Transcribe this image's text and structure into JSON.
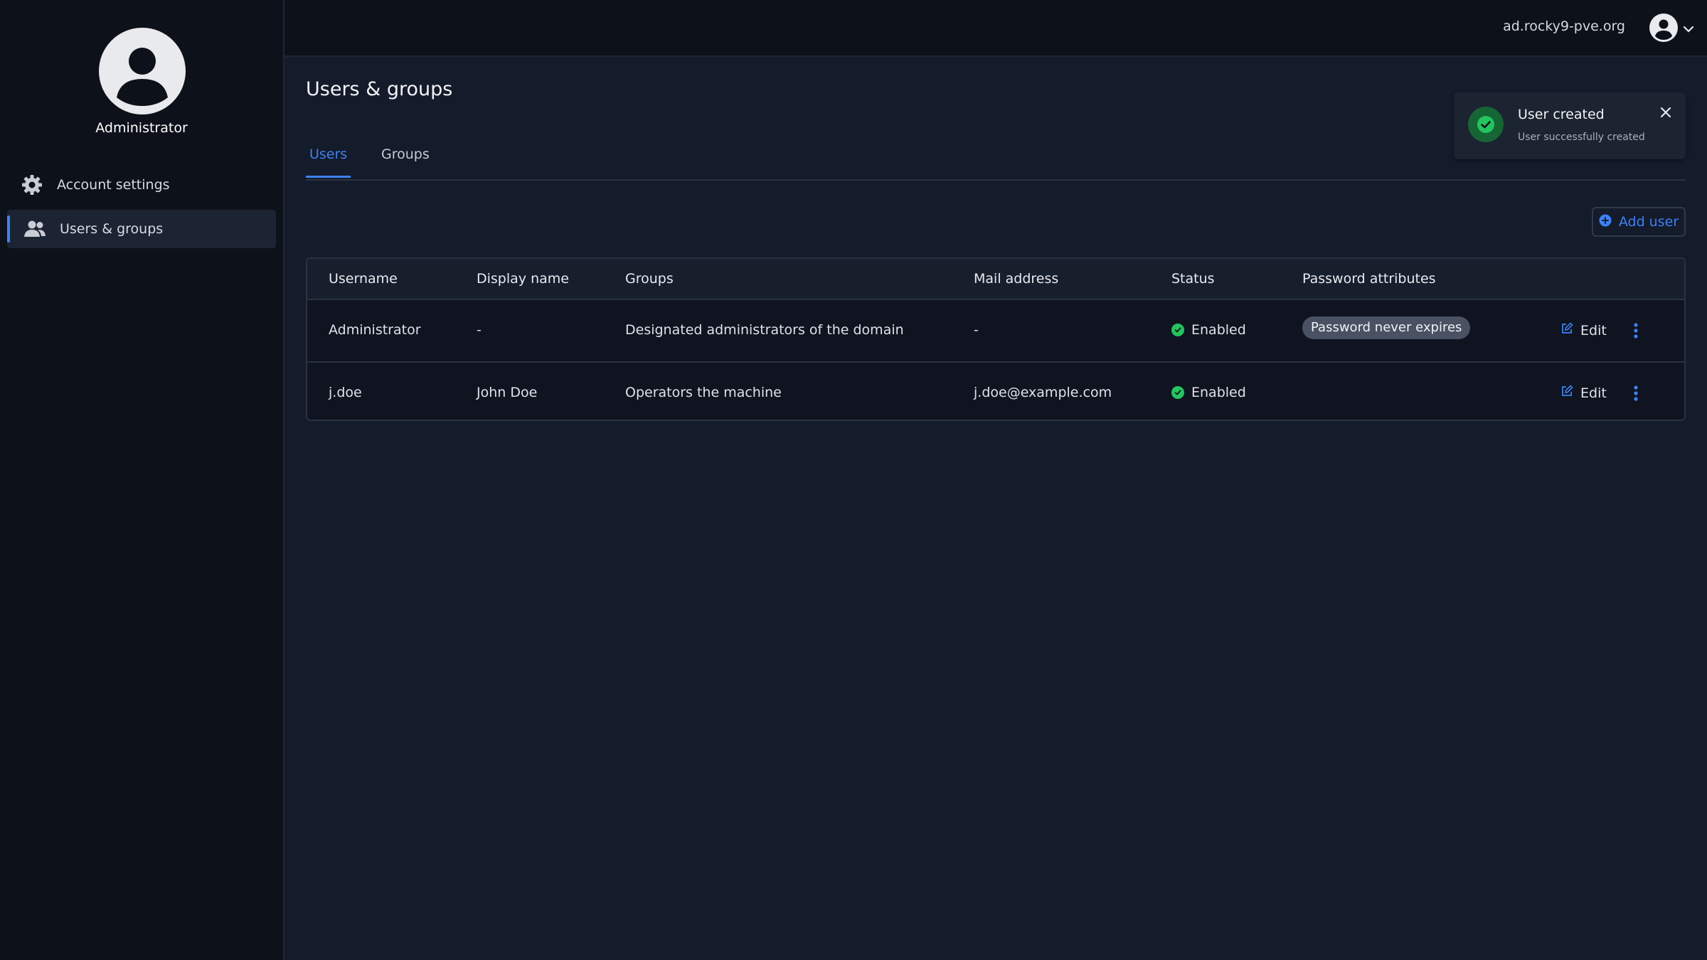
{
  "sidebar": {
    "user_name": "Administrator",
    "items": [
      {
        "label": "Account settings",
        "icon": "gear-icon"
      },
      {
        "label": "Users & groups",
        "icon": "users-icon",
        "active": true
      }
    ]
  },
  "topbar": {
    "domain": "ad.rocky9-pve.org"
  },
  "main": {
    "title": "Users & groups",
    "tabs": [
      {
        "label": "Users",
        "active": true
      },
      {
        "label": "Groups",
        "active": false
      }
    ],
    "add_button_label": "Add user"
  },
  "toast": {
    "title": "User created",
    "message": "User successfully created"
  },
  "table": {
    "columns": [
      "Username",
      "Display name",
      "Groups",
      "Mail address",
      "Status",
      "Password attributes"
    ],
    "rows": [
      {
        "username": "Administrator",
        "display_name": "-",
        "groups": "Designated administrators of the domain",
        "mail": "-",
        "status": "Enabled",
        "password_attribute": "Password never expires",
        "edit_label": "Edit"
      },
      {
        "username": "j.doe",
        "display_name": "John Doe",
        "groups": "Operators the machine",
        "mail": "j.doe@example.com",
        "status": "Enabled",
        "password_attribute": "",
        "edit_label": "Edit"
      }
    ]
  },
  "colors": {
    "accent": "#3b82f6",
    "success": "#22c55e",
    "background": "#141b2a",
    "sidebar": "#0d1119"
  }
}
